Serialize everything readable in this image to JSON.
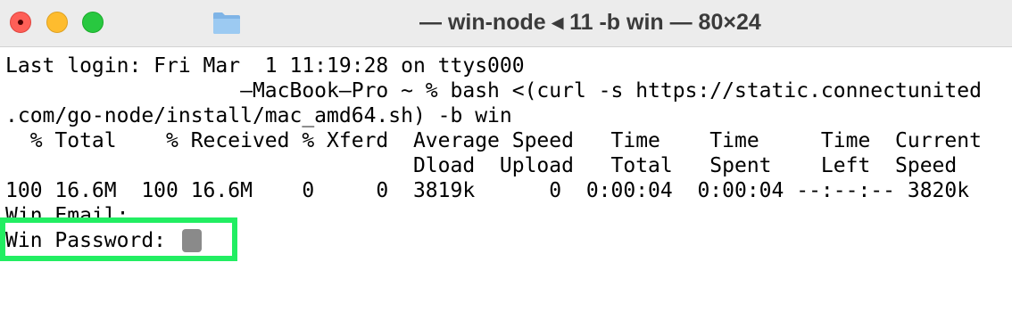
{
  "window": {
    "title": "— win-node ◂ 11 -b win — 80×24"
  },
  "terminal": {
    "lines": [
      "Last login: Fri Mar  1 11:19:28 on ttys000",
      "                   —MacBook—Pro ~ % bash <(curl -s https://static.connectunited",
      ".com/go-node/install/mac_amd64.sh) -b win",
      "  % Total    % Received % Xferd  Average Speed   Time    Time     Time  Current",
      "                                 Dload  Upload   Total   Spent    Left  Speed",
      "100 16.6M  100 16.6M    0     0  3819k      0  0:00:04  0:00:04 --:--:-- 3820k",
      "Win Email:"
    ],
    "password_prompt": "Win Password: "
  },
  "icons": {
    "key": "key-icon",
    "folder": "folder-icon"
  },
  "colors": {
    "highlight": "#22ee62",
    "close": "#fe5f57",
    "minimize": "#febc2e",
    "maximize": "#28c840"
  }
}
